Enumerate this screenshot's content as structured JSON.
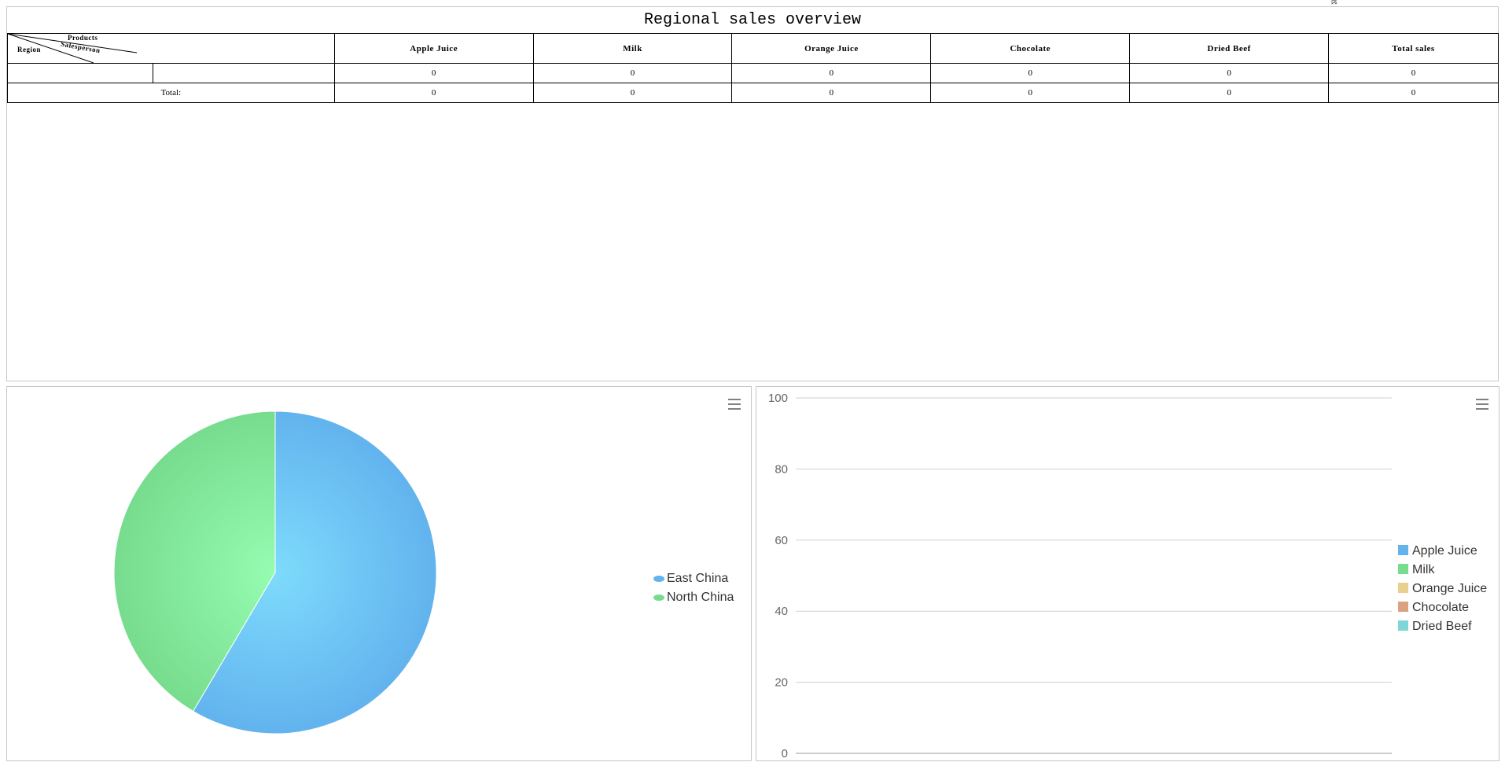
{
  "report": {
    "title": "Regional sales overview",
    "corner": {
      "products": "Products",
      "salesperson": "Salesperson",
      "region": "Region"
    },
    "columns": [
      "Apple Juice",
      "Milk",
      "Orange Juice",
      "Chocolate",
      "Dried Beef",
      "Total sales"
    ],
    "rows": [
      {
        "region": "",
        "salesperson": "",
        "values": [
          "0",
          "0",
          "0",
          "0",
          "0",
          "0"
        ]
      }
    ],
    "total": {
      "label": "Total:",
      "values": [
        "0",
        "0",
        "0",
        "0",
        "0",
        "0"
      ]
    }
  },
  "pie_chart": {
    "menu_icon": "hamburger-menu-icon",
    "legend": [
      {
        "name": "East China",
        "color": "#62b3ee"
      },
      {
        "name": "North China",
        "color": "#78dc8e"
      }
    ]
  },
  "bar_chart": {
    "menu_icon": "hamburger-menu-icon",
    "legend": [
      {
        "name": "Apple Juice",
        "color": "#62b3ee"
      },
      {
        "name": "Milk",
        "color": "#78dc8e"
      },
      {
        "name": "Orange Juice",
        "color": "#ead08f"
      },
      {
        "name": "Chocolate",
        "color": "#daa283"
      },
      {
        "name": "Dried Beef",
        "color": "#7dd7d6"
      }
    ]
  },
  "chart_data": [
    {
      "type": "pie",
      "labels": [
        "East China",
        "North China"
      ],
      "values": [
        58.5,
        41.5
      ],
      "colors": [
        "#62b3ee",
        "#78dc8e"
      ]
    },
    {
      "type": "bar",
      "categories": [],
      "series": [
        {
          "name": "Apple Juice",
          "values": []
        },
        {
          "name": "Milk",
          "values": []
        },
        {
          "name": "Orange Juice",
          "values": []
        },
        {
          "name": "Chocolate",
          "values": []
        },
        {
          "name": "Dried Beef",
          "values": []
        }
      ],
      "yticks": [
        "0",
        "20",
        "40",
        "60",
        "80",
        "100"
      ],
      "ylim": [
        0,
        100
      ],
      "grid": true,
      "legend_position": "right"
    }
  ]
}
